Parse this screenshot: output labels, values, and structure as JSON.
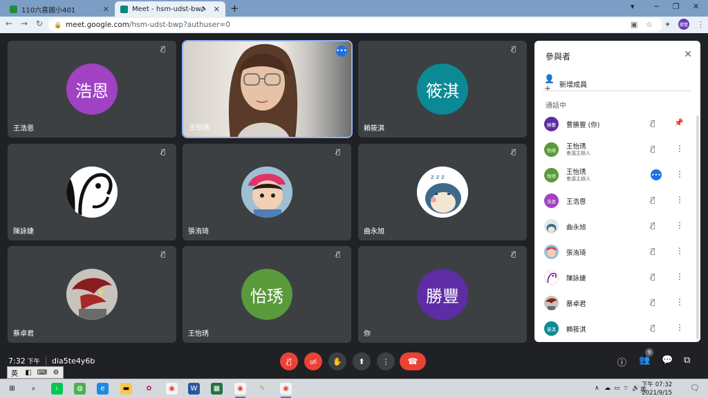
{
  "browser": {
    "tabs": [
      {
        "title": "110六喜國小401",
        "favicon_color": "#1e8e3e"
      },
      {
        "title": "Meet - hsm-udst-bwp",
        "favicon_color": "#00897b"
      }
    ],
    "url_host": "meet.google.com",
    "url_path": "/hsm-udst-bwp?authuser=0",
    "profile_initials": "勝豐"
  },
  "grid": {
    "tiles": [
      {
        "name": "王浩恩",
        "avatar_text": "浩恩",
        "avatar_color": "#a142c4",
        "muted": true
      },
      {
        "name": "王怡琇",
        "video": true,
        "muted": false
      },
      {
        "name": "賴筱淇",
        "avatar_text": "筱淇",
        "avatar_color": "#0b8a96",
        "muted": true
      },
      {
        "name": "陳詠婕",
        "avatar_image": "bird-drawing",
        "muted": true
      },
      {
        "name": "張洧琦",
        "avatar_image": "child-photo",
        "muted": true
      },
      {
        "name": "曲永旭",
        "avatar_image": "snorlax",
        "muted": true
      },
      {
        "name": "蔡卓君",
        "avatar_image": "dragon",
        "muted": true
      },
      {
        "name": "王怡琇",
        "avatar_text": "怡琇",
        "avatar_color": "#5a9a3a",
        "muted": true
      },
      {
        "name": "你",
        "avatar_text": "勝豐",
        "avatar_color": "#5e2ca5",
        "muted": true
      }
    ]
  },
  "bottom": {
    "time": "7:32",
    "ampm": "下午",
    "meeting_code": "dia5te4y6b",
    "participant_count": "9"
  },
  "panel": {
    "title": "參與者",
    "add_label": "新增成員",
    "section_label": "通話中",
    "participants": [
      {
        "avatar_text": "勝豐",
        "avatar_color": "#5e2ca5",
        "name": "曹勝豐 (你)",
        "role": "",
        "action": "pin"
      },
      {
        "avatar_text": "怡琇",
        "avatar_color": "#5a9a3a",
        "name": "王怡琇",
        "role": "會議主辦人",
        "action": "more"
      },
      {
        "avatar_text": "怡琇",
        "avatar_color": "#5a9a3a",
        "name": "王怡琇",
        "role": "會議主辦人",
        "action": "more",
        "speaking": true
      },
      {
        "avatar_text": "浩恩",
        "avatar_color": "#a142c4",
        "name": "王浩恩",
        "role": "",
        "action": "more"
      },
      {
        "avatar_text": "",
        "avatar_color": "#dfe7ef",
        "name": "曲永旭",
        "role": "",
        "action": "more"
      },
      {
        "avatar_text": "",
        "avatar_color": "#e88a9a",
        "name": "張洧琦",
        "role": "",
        "action": "more"
      },
      {
        "avatar_text": "",
        "avatar_color": "#ffffff",
        "name": "陳詠婕",
        "role": "",
        "action": "more"
      },
      {
        "avatar_text": "",
        "avatar_color": "#7a4a3a",
        "name": "蔡卓君",
        "role": "",
        "action": "more"
      },
      {
        "avatar_text": "筱淇",
        "avatar_color": "#0b8a96",
        "name": "賴筱淇",
        "role": "",
        "action": "more"
      }
    ]
  },
  "taskbar": {
    "ime_lang": "英",
    "clock_ampm_time": "下午 07:32",
    "clock_date": "2021/9/15",
    "tray_lang": "英"
  }
}
